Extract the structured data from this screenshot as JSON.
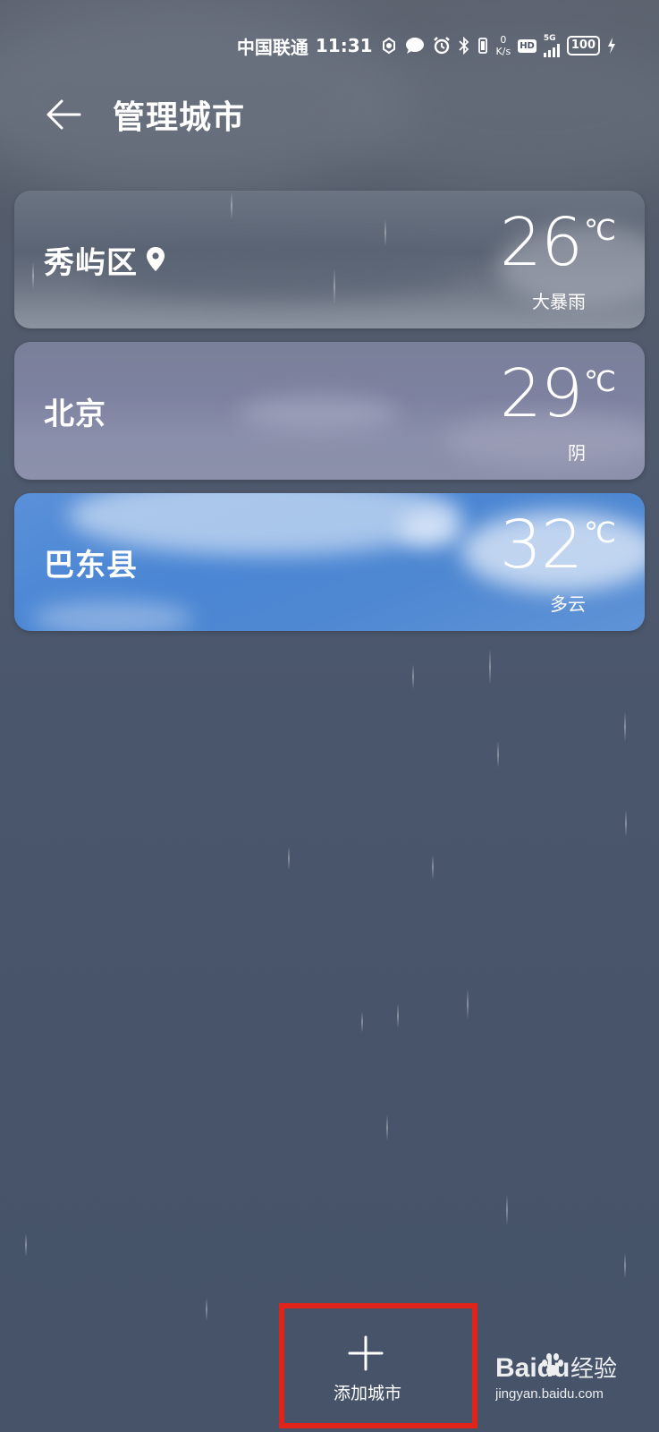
{
  "status_bar": {
    "carrier": "中国联通",
    "time": "11:31",
    "speed_value": "0",
    "speed_unit": "K/s",
    "hd": "HD",
    "network": "5G",
    "battery": "100"
  },
  "header": {
    "title": "管理城市"
  },
  "cities": [
    {
      "name": "秀屿区",
      "temp": "26",
      "unit": "℃",
      "condition": "大暴雨",
      "current_location": true
    },
    {
      "name": "北京",
      "temp": "29",
      "unit": "℃",
      "condition": "阴"
    },
    {
      "name": "巴东县",
      "temp": "32",
      "unit": "℃",
      "condition": "多云"
    }
  ],
  "add_city": {
    "label": "添加城市",
    "highlight_color": "#e2231a"
  },
  "watermark": {
    "brand": "Baidu",
    "text": "经验",
    "url": "jingyan.baidu.com"
  }
}
